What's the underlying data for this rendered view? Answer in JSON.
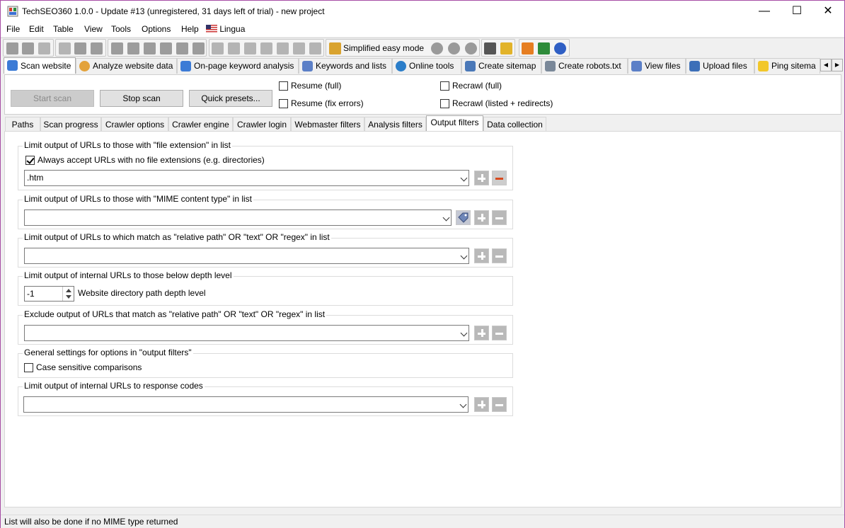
{
  "window": {
    "title": "TechSEO360 1.0.0 - Update #13 (unregistered, 31 days left of trial) - new project",
    "minimize": "—",
    "maximize": "☐",
    "close": "✕"
  },
  "menu": {
    "items": [
      "File",
      "Edit",
      "Table",
      "View",
      "Tools",
      "Options",
      "Help",
      "Lingua"
    ]
  },
  "toolbar": {
    "simplified_mode_label": "Simplified easy mode"
  },
  "main_tabs": [
    {
      "label": "Scan website",
      "icon": "magnifier-icon",
      "active": true
    },
    {
      "label": "Analyze website data",
      "icon": "pie-chart-icon"
    },
    {
      "label": "On-page keyword analysis",
      "icon": "magnifier-icon"
    },
    {
      "label": "Keywords and lists",
      "icon": "list-icon"
    },
    {
      "label": "Online tools",
      "icon": "globe-icon"
    },
    {
      "label": "Create sitemap",
      "icon": "sitemap-icon"
    },
    {
      "label": "Create robots.txt",
      "icon": "filter-icon"
    },
    {
      "label": "View files",
      "icon": "list-icon"
    },
    {
      "label": "Upload files",
      "icon": "upload-icon"
    },
    {
      "label": "Ping sitema",
      "icon": "lightning-icon"
    }
  ],
  "scan": {
    "start_label": "Start scan",
    "stop_label": "Stop scan",
    "presets_label": "Quick presets...",
    "options": [
      {
        "label": "Resume (full)",
        "checked": false
      },
      {
        "label": "Resume (fix errors)",
        "checked": false
      },
      {
        "label": "Recrawl (full)",
        "checked": false
      },
      {
        "label": "Recrawl (listed + redirects)",
        "checked": false
      }
    ]
  },
  "sub_tabs": [
    {
      "label": "Paths"
    },
    {
      "label": "Scan progress"
    },
    {
      "label": "Crawler options"
    },
    {
      "label": "Crawler engine"
    },
    {
      "label": "Crawler login"
    },
    {
      "label": "Webmaster filters"
    },
    {
      "label": "Analysis filters"
    },
    {
      "label": "Output filters",
      "active": true
    },
    {
      "label": "Data collection"
    }
  ],
  "output_filters": {
    "file_extension": {
      "legend": "Limit output of URLs to those with \"file extension\" in list",
      "checkbox_label": "Always accept URLs with no file extensions (e.g. directories)",
      "checkbox_checked": true,
      "value": ".htm"
    },
    "mime_type": {
      "legend": "Limit output of URLs to those with \"MIME content type\" in list",
      "value": ""
    },
    "relative_path": {
      "legend": "Limit output of URLs to which match as \"relative path\" OR \"text\" OR \"regex\" in list",
      "value": ""
    },
    "depth": {
      "legend": "Limit output of internal URLs to those below depth level",
      "value": "-1",
      "label": "Website directory path depth level"
    },
    "exclude": {
      "legend": "Exclude output of URLs that match as \"relative path\" OR \"text\" OR \"regex\" in list",
      "value": ""
    },
    "general": {
      "legend": "General settings for options in \"output filters\"",
      "checkbox_label": "Case sensitive comparisons",
      "checkbox_checked": false
    },
    "response_codes": {
      "legend": "Limit output of internal URLs to response codes",
      "value": ""
    }
  },
  "status": {
    "text": "List will also be done if no MIME type returned"
  }
}
